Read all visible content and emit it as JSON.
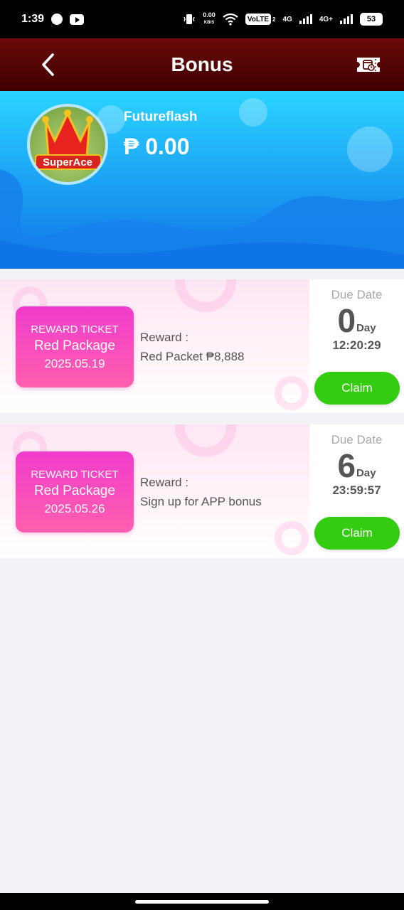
{
  "status_bar": {
    "time": "1:39",
    "net_speed_value": "0.00",
    "net_speed_unit": "KB/S",
    "volte": "VoLTE",
    "sim_slot": "2",
    "net1": "4G",
    "net2": "4G+",
    "battery": "53"
  },
  "header": {
    "title": "Bonus",
    "back_icon": "chevron-left-icon",
    "right_icon": "ticket-icon"
  },
  "profile": {
    "username": "Futureflash",
    "balance": "₱ 0.00",
    "avatar_logo_text": "SuperAce"
  },
  "rewards": [
    {
      "ticket_type": "REWARD TICKET",
      "ticket_name": "Red Package",
      "ticket_date": "2025.05.19",
      "reward_label": "Reward :",
      "reward_value": "Red Packet ₱8,888",
      "due_label": "Due Date",
      "due_days": "0",
      "due_unit": "Day",
      "due_time": "12:20:29",
      "claim_label": "Claim"
    },
    {
      "ticket_type": "REWARD TICKET",
      "ticket_name": "Red Package",
      "ticket_date": "2025.05.26",
      "reward_label": "Reward :",
      "reward_value": "Sign up for APP bonus",
      "due_label": "Due Date",
      "due_days": "6",
      "due_unit": "Day",
      "due_time": "23:59:57",
      "claim_label": "Claim"
    }
  ],
  "colors": {
    "header_bg": "#5a0505",
    "banner_blue": "#1ea8f5",
    "ticket_pink": "#f03ccc",
    "claim_green": "#33cc10"
  }
}
